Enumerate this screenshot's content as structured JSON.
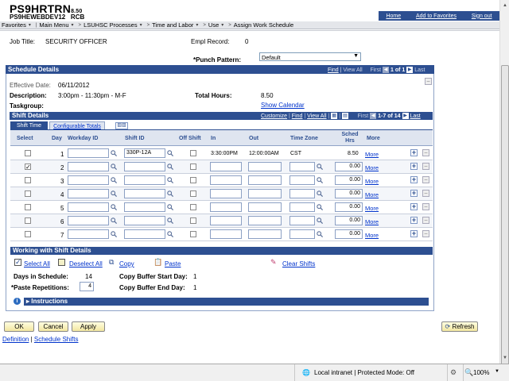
{
  "header": {
    "app_name": "PS9HRTRN",
    "app_version": "8.50",
    "db_name": "PS9HEWEBDEV12",
    "db_user": "RCB",
    "nav": [
      "Home",
      "Add to Favorites",
      "Sign out"
    ]
  },
  "breadcrumbs": [
    "Favorites",
    "Main Menu",
    "LSUHSC Processes",
    "Time and Labor",
    "Use",
    "Assign Work Schedule"
  ],
  "top_fields": {
    "job_title_label": "Job Title:",
    "job_title_value": "SECURITY OFFICER",
    "empl_record_label": "Empl Record:",
    "empl_record_value": "0",
    "punch_pattern_label": "*Punch Pattern:",
    "punch_pattern_value": "Default"
  },
  "schedule": {
    "title": "Schedule Details",
    "nav_find": "Find",
    "nav_viewall": "View All",
    "nav_first": "First",
    "nav_count": "1 of 1",
    "nav_last": "Last",
    "effective_date_label": "Effective Date:",
    "effective_date_value": "06/11/2012",
    "description_label": "Description:",
    "description_value": "3:00pm - 11:30pm - M-F",
    "total_hours_label": "Total Hours:",
    "total_hours_value": "8.50",
    "taskgroup_label": "Taskgroup:",
    "show_calendar": "Show Calendar"
  },
  "shift": {
    "title": "Shift Details",
    "customize": "Customize",
    "find": "Find",
    "view_all": "View All",
    "first": "First",
    "count": "1-7 of 14",
    "last": "Last",
    "tabs": [
      "Shift Time",
      "Configurable Totals"
    ],
    "columns": [
      "Select",
      "Day",
      "Workday ID",
      "Shift ID",
      "Off Shift",
      "In",
      "Out",
      "Time Zone",
      "Sched Hrs",
      "More"
    ],
    "more_label": "More",
    "rows": [
      {
        "day": "1",
        "selected": false,
        "shift_id": "330P-12A",
        "in": "3:30:00PM",
        "out": "12:00:00AM",
        "tz": "CST",
        "hrs": "8.50",
        "hrs_input": false
      },
      {
        "day": "2",
        "selected": true,
        "shift_id": "",
        "in": "",
        "out": "",
        "tz": "",
        "hrs": "0.00",
        "hrs_input": true
      },
      {
        "day": "3",
        "selected": false,
        "shift_id": "",
        "in": "",
        "out": "",
        "tz": "",
        "hrs": "0.00",
        "hrs_input": true
      },
      {
        "day": "4",
        "selected": false,
        "shift_id": "",
        "in": "",
        "out": "",
        "tz": "",
        "hrs": "0.00",
        "hrs_input": true
      },
      {
        "day": "5",
        "selected": false,
        "shift_id": "",
        "in": "",
        "out": "",
        "tz": "",
        "hrs": "0.00",
        "hrs_input": true
      },
      {
        "day": "6",
        "selected": false,
        "shift_id": "",
        "in": "",
        "out": "",
        "tz": "",
        "hrs": "0.00",
        "hrs_input": true
      },
      {
        "day": "7",
        "selected": false,
        "shift_id": "",
        "in": "",
        "out": "",
        "tz": "",
        "hrs": "0.00",
        "hrs_input": true
      }
    ]
  },
  "working": {
    "title": "Working with Shift Details",
    "select_all": "Select All",
    "deselect_all": "Deselect All",
    "copy": "Copy",
    "paste": "Paste",
    "clear_shifts": "Clear Shifts",
    "days_label": "Days in Schedule:",
    "days_value": "14",
    "paste_label": "*Paste Repetitions:",
    "paste_value": "4",
    "start_label": "Copy Buffer Start Day:",
    "start_value": "1",
    "end_label": "Copy Buffer End Day:",
    "end_value": "1",
    "instructions": "Instructions"
  },
  "buttons": {
    "ok": "OK",
    "cancel": "Cancel",
    "apply": "Apply",
    "refresh": "Refresh"
  },
  "footer_links": [
    "Definition",
    "Schedule Shifts"
  ],
  "status": {
    "zone": "Local intranet | Protected Mode: Off",
    "zoom": "100%"
  },
  "colors": {
    "accent": "#2d4f91",
    "link": "#0033cc"
  }
}
